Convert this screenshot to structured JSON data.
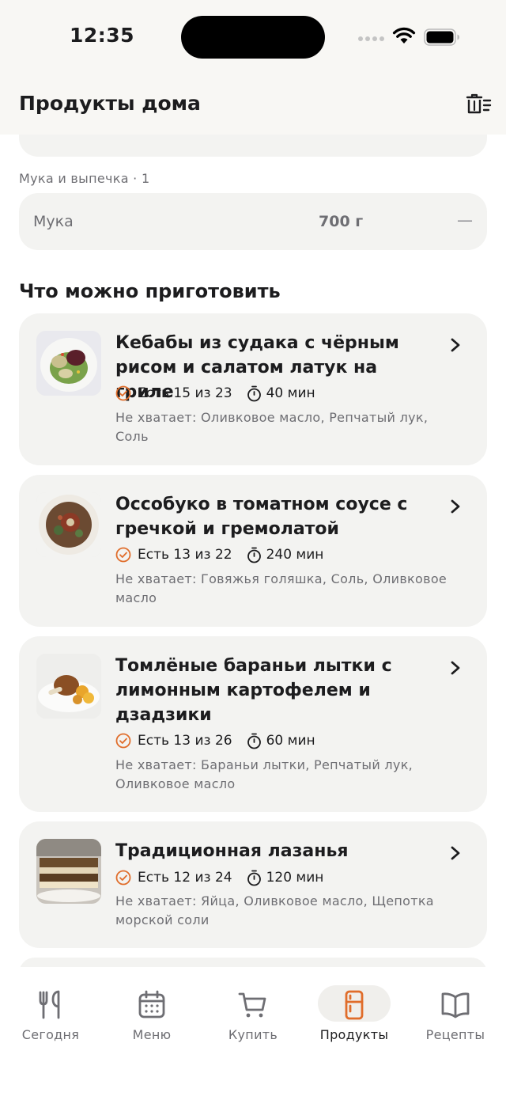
{
  "status_bar": {
    "time": "12:35"
  },
  "header": {
    "title": "Продукты дома"
  },
  "pantry": {
    "section_caption": "Мука и выпечка · 1",
    "items": [
      {
        "name": "Мука",
        "quantity": "700 г",
        "remove": "—"
      }
    ]
  },
  "recipes_section": {
    "title": "Что можно приготовить",
    "recipes": [
      {
        "title": "Кебабы из судака с чёрным рисом и салатом латук на гриле",
        "have": "Есть 15 из 23",
        "time": "40 мин",
        "missing": "Не хватает: Оливковое масло, Репчатый лук, Соль"
      },
      {
        "title": "Оссобуко в томатном соусе с гречкой и гремолатой",
        "have": "Есть 13 из 22",
        "time": "240 мин",
        "missing": "Не хватает: Говяжья голяшка, Соль, Оливковое масло"
      },
      {
        "title": "Томлёные бараньи лытки с лимонным картофелем и дзадзики",
        "have": "Есть 13 из 26",
        "time": "60 мин",
        "missing": "Не хватает: Бараньи лытки, Репчатый лук, Оливковое масло"
      },
      {
        "title": "Традиционная лазанья",
        "have": "Есть 12 из 24",
        "time": "120 мин",
        "missing": "Не хватает: Яйца, Оливковое масло, Щепотка морской соли"
      }
    ]
  },
  "tabs": [
    {
      "label": "Сегодня",
      "icon": "fork-knife-icon"
    },
    {
      "label": "Меню",
      "icon": "calendar-icon"
    },
    {
      "label": "Купить",
      "icon": "cart-icon"
    },
    {
      "label": "Продукты",
      "icon": "fridge-icon",
      "active": true
    },
    {
      "label": "Рецепты",
      "icon": "book-icon"
    }
  ],
  "colors": {
    "accent": "#e06d2b",
    "card": "#f3f3f1",
    "header_bg": "#f8f7f4",
    "muted_text": "#6e6e73"
  }
}
